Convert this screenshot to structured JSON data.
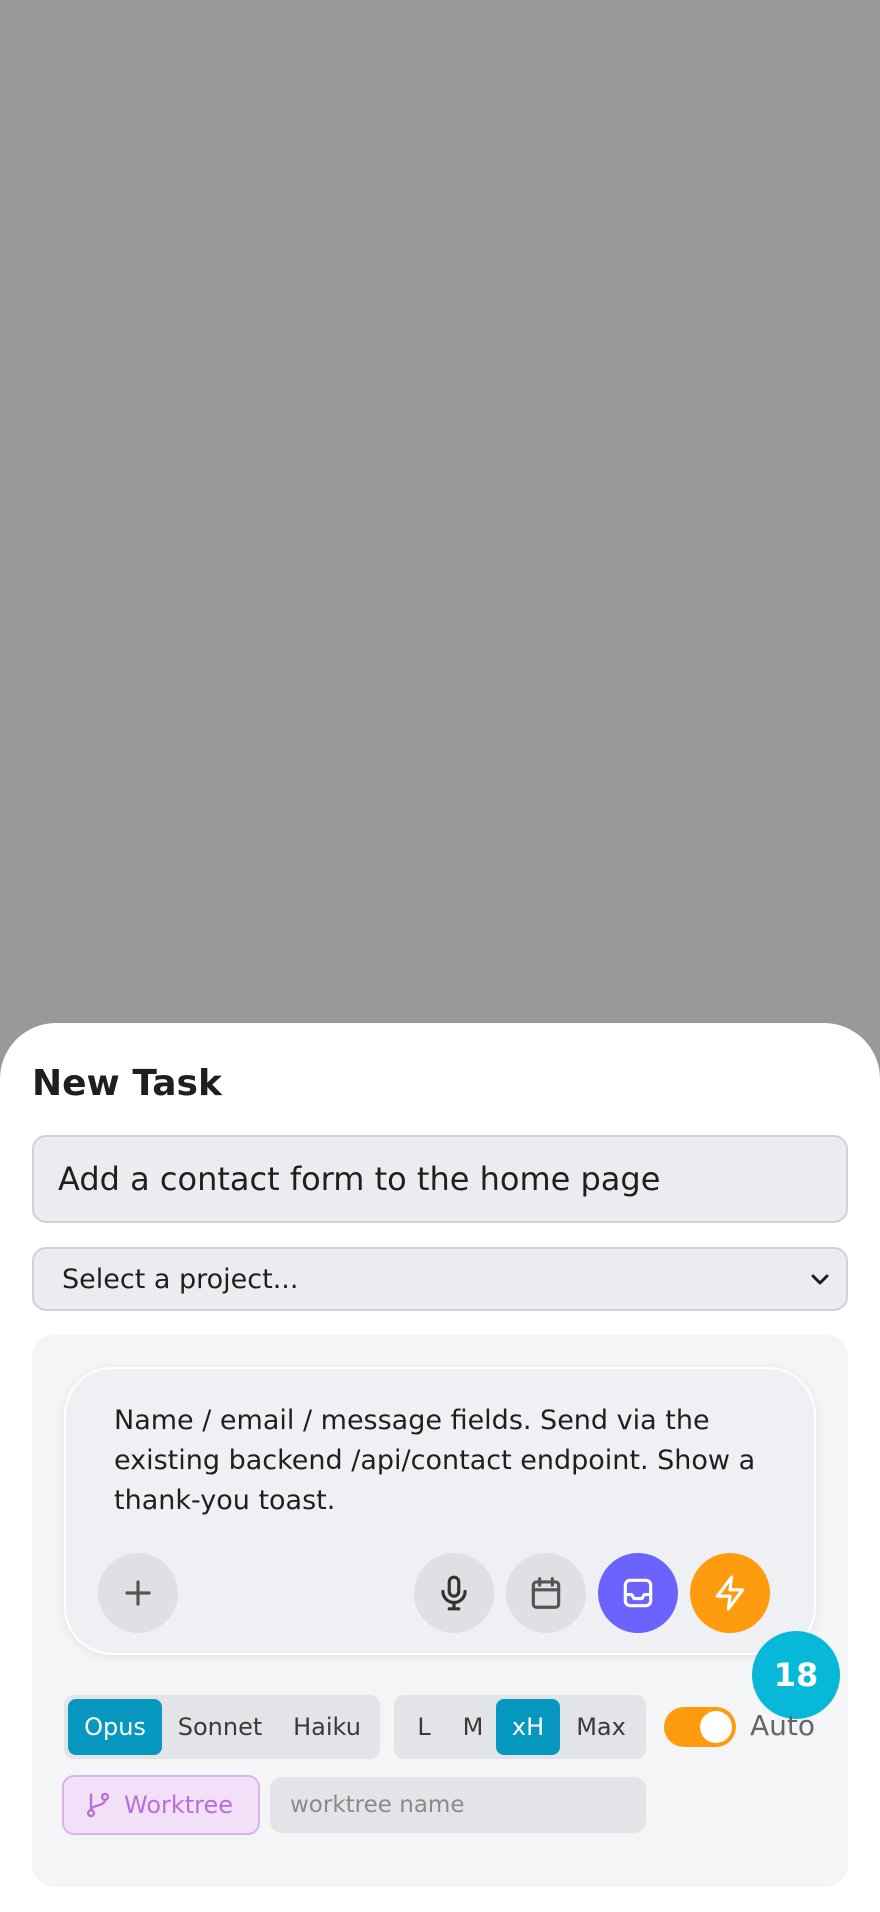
{
  "sheet": {
    "title": "New Task"
  },
  "task": {
    "title_value": "Add a contact form to the home page"
  },
  "project": {
    "selected": "Select a project..."
  },
  "composer": {
    "text": "Name / email / message fields. Send via the existing backend /api/contact endpoint. Show a thank-you toast.",
    "buttons": [
      {
        "icon": "plus-icon"
      },
      {
        "icon": "microphone-icon"
      },
      {
        "icon": "calendar-icon"
      },
      {
        "icon": "inbox-icon",
        "color": "#6c63fe"
      },
      {
        "icon": "lightning-icon",
        "color": "#ff9b0f"
      }
    ]
  },
  "badge": {
    "count": "18",
    "color": "#08b8d9"
  },
  "models": {
    "options": [
      "Opus",
      "Sonnet",
      "Haiku"
    ],
    "selected": "Opus"
  },
  "effort": {
    "options": [
      "L",
      "M",
      "xH",
      "Max"
    ],
    "selected": "xH"
  },
  "auto": {
    "label": "Auto",
    "enabled": true,
    "color": "#ff9b0f"
  },
  "worktree": {
    "button_label": "Worktree",
    "placeholder": "worktree name"
  },
  "colors": {
    "accent": "#0698be",
    "purple": "#6c63fe",
    "orange": "#ff9b0f"
  }
}
